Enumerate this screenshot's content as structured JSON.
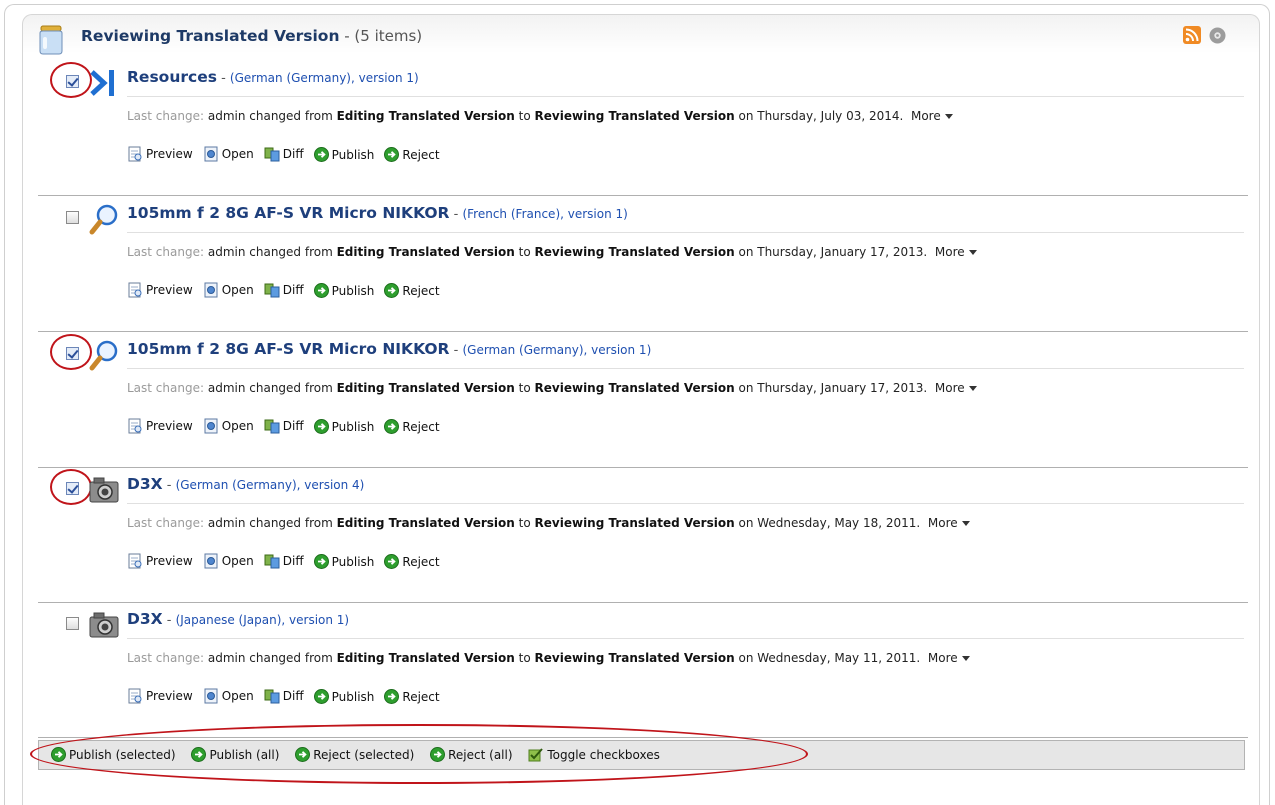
{
  "header": {
    "title": "Reviewing Translated Version",
    "count": " - (5 items)",
    "rss_icon": "rss-feed-icon",
    "settings_icon": "gear-icon",
    "jar_icon": "collection-jar-icon"
  },
  "items": [
    {
      "checked": true,
      "highlighted": true,
      "icon": "resources-arrow-icon",
      "title": "Resources",
      "meta": "(German (Germany), version 1)",
      "change_label": "Last change:",
      "change_user": "admin changed from",
      "from_state": "Editing Translated Version",
      "to_word": "to",
      "to_state": "Reviewing Translated Version",
      "on_text": "on Thursday, July 03, 2014.",
      "more": "More"
    },
    {
      "checked": false,
      "highlighted": false,
      "icon": "magnifier-icon",
      "title": "105mm f 2 8G AF-S VR Micro NIKKOR",
      "meta": "(French (France), version 1)",
      "change_label": "Last change:",
      "change_user": "admin changed from",
      "from_state": "Editing Translated Version",
      "to_word": "to",
      "to_state": "Reviewing Translated Version",
      "on_text": "on Thursday, January 17, 2013.",
      "more": "More"
    },
    {
      "checked": true,
      "highlighted": true,
      "icon": "magnifier-icon",
      "title": "105mm f 2 8G AF-S VR Micro NIKKOR",
      "meta": "(German (Germany), version 1)",
      "change_label": "Last change:",
      "change_user": "admin changed from",
      "from_state": "Editing Translated Version",
      "to_word": "to",
      "to_state": "Reviewing Translated Version",
      "on_text": "on Thursday, January 17, 2013.",
      "more": "More"
    },
    {
      "checked": true,
      "highlighted": true,
      "icon": "camera-icon",
      "title": "D3X",
      "meta": "(German (Germany), version 4)",
      "change_label": "Last change:",
      "change_user": "admin changed from",
      "from_state": "Editing Translated Version",
      "to_word": "to",
      "to_state": "Reviewing Translated Version",
      "on_text": "on Wednesday, May 18, 2011.",
      "more": "More"
    },
    {
      "checked": false,
      "highlighted": false,
      "icon": "camera-icon",
      "title": "D3X",
      "meta": "(Japanese (Japan), version 1)",
      "change_label": "Last change:",
      "change_user": "admin changed from",
      "from_state": "Editing Translated Version",
      "to_word": "to",
      "to_state": "Reviewing Translated Version",
      "on_text": "on Wednesday, May 11, 2011.",
      "more": "More"
    }
  ],
  "item_actions": {
    "preview": "Preview",
    "open": "Open",
    "diff": "Diff",
    "publish": "Publish",
    "reject": "Reject"
  },
  "footer": {
    "publish_selected": "Publish (selected)",
    "publish_all": "Publish (all)",
    "reject_selected": "Reject (selected)",
    "reject_all": "Reject (all)",
    "toggle_checkboxes": "Toggle checkboxes"
  },
  "colors": {
    "title": "#1e3f7c",
    "meta": "#1e4fb0",
    "annotation": "#c0141a",
    "go_green": "#2e9e2e"
  }
}
